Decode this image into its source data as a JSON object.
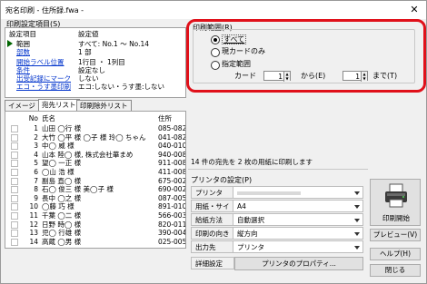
{
  "window": {
    "title": "宛名印刷 - 住所録.fwa -",
    "close_glyph": "✕"
  },
  "settings": {
    "group_label": "印刷設定項目(S)",
    "header": {
      "key": "設定項目",
      "value": "設定値"
    },
    "rows": [
      {
        "key": "範囲",
        "value": "すべて: No.1 〜 No.14",
        "selected": true
      },
      {
        "key": "部数",
        "value": "1 部"
      },
      {
        "key": "開始ラベル位置",
        "value": "1行目 ・ 1列目"
      },
      {
        "key": "条件",
        "value": "設定なし"
      },
      {
        "key": "出受記録にマーク",
        "value": "しない"
      },
      {
        "key": "エコ・うす墨印刷",
        "value": "エコ:しない・うす墨:しない"
      }
    ]
  },
  "tabs": [
    {
      "label": "イメージ"
    },
    {
      "label": "宛先リスト",
      "active": true
    },
    {
      "label": "印刷除外リスト"
    }
  ],
  "list": {
    "headers": {
      "no": "No",
      "name": "氏名",
      "address": "住所"
    },
    "rows": [
      {
        "no": "1",
        "name": "山田 ◯行 様",
        "addr": "085-082"
      },
      {
        "no": "2",
        "name": "大竹 ◯平 様 ◯子 様 玲◯ ちゃん",
        "addr": "041-082"
      },
      {
        "no": "3",
        "name": "中◯ 威 様",
        "addr": "040-010"
      },
      {
        "no": "4",
        "name": "山本 陸◯ 様, 株式会社華まめ",
        "addr": "940-008"
      },
      {
        "no": "5",
        "name": "望◯ 一正 様",
        "addr": "911-008"
      },
      {
        "no": "6",
        "name": "◯山 浩 様",
        "addr": "411-008"
      },
      {
        "no": "7",
        "name": "副島 直◯ 様",
        "addr": "675-002"
      },
      {
        "no": "8",
        "name": "石◯ 俊三 様 美◯子 様",
        "addr": "690-002"
      },
      {
        "no": "9",
        "name": "長中 ◯之 様",
        "addr": "087-005"
      },
      {
        "no": "10",
        "name": "◯藤 巧 様",
        "addr": "891-010"
      },
      {
        "no": "11",
        "name": "千葉 ◯二 様",
        "addr": "566-003"
      },
      {
        "no": "12",
        "name": "日野 時◯ 様",
        "addr": "820-011"
      },
      {
        "no": "13",
        "name": "児◯ 行雄 様",
        "addr": "390-004"
      },
      {
        "no": "14",
        "name": "高蔵 ◯男 様",
        "addr": "025-005"
      }
    ]
  },
  "range": {
    "group_label": "印刷範囲(R)",
    "options": [
      {
        "label": "すべて",
        "selected": true
      },
      {
        "label": "現カードのみ",
        "selected": false
      },
      {
        "label": "指定範囲",
        "selected": false
      }
    ],
    "card_label": "カード",
    "from_value": "1",
    "from_label": "から(E)",
    "to_value": "1",
    "to_label": "まで(T)"
  },
  "info_text": "14 件の宛先を 2 枚の用紙に印刷します",
  "printer": {
    "group_label": "プリンタの設定(P)",
    "rows": [
      {
        "key": "プリンタ",
        "value": "",
        "dropdown": true
      },
      {
        "key": "用紙・サイズ",
        "value": "A4",
        "dropdown": true
      },
      {
        "key": "給紙方法",
        "value": "自動選択",
        "dropdown": true
      },
      {
        "key": "印刷の向き",
        "value": "縦方向",
        "dropdown": true
      },
      {
        "key": "出力先",
        "value": "プリンタ",
        "dropdown": true
      },
      {
        "key": "詳細設定",
        "value": "プリンタのプロパティ..."
      }
    ]
  },
  "buttons": {
    "print": "印刷開始",
    "preview": "プレビュー(V)",
    "help": "ヘルプ(H)",
    "close": "閉じる"
  },
  "colors": {
    "highlight": "#e0101a",
    "link": "#0033cc",
    "arrow": "#006400"
  }
}
